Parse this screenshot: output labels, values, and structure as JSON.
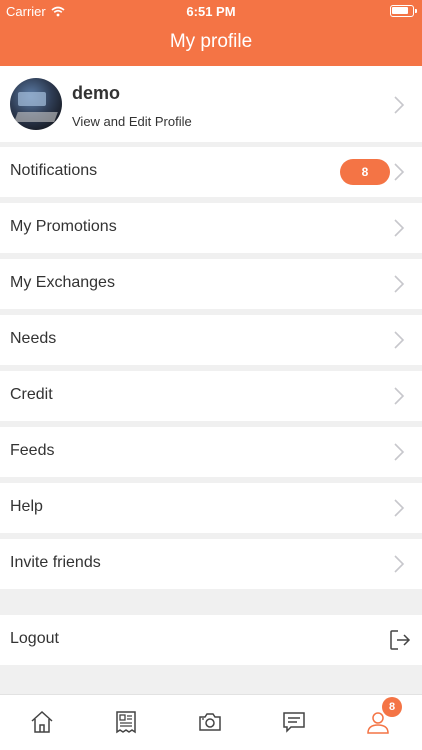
{
  "status_bar": {
    "carrier": "Carrier",
    "time": "6:51 PM"
  },
  "header": {
    "title": "My profile"
  },
  "profile": {
    "name": "demo",
    "subtitle": "View and Edit Profile"
  },
  "menu": {
    "notifications": {
      "label": "Notifications",
      "badge": "8"
    },
    "promotions": {
      "label": "My Promotions"
    },
    "exchanges": {
      "label": "My Exchanges"
    },
    "needs": {
      "label": "Needs"
    },
    "credit": {
      "label": "Credit"
    },
    "feeds": {
      "label": "Feeds"
    },
    "help": {
      "label": "Help"
    },
    "invite": {
      "label": "Invite friends"
    }
  },
  "logout": {
    "label": "Logout"
  },
  "tab_bar": {
    "tabs": [
      {
        "icon": "home-icon"
      },
      {
        "icon": "receipt-icon"
      },
      {
        "icon": "camera-icon"
      },
      {
        "icon": "chat-icon"
      },
      {
        "icon": "profile-icon",
        "badge": "8",
        "active": true
      }
    ]
  },
  "colors": {
    "accent": "#f47445",
    "background": "#f0f0f0",
    "text": "#333333",
    "icon": "#444444",
    "chevron": "#c7c7cc"
  }
}
